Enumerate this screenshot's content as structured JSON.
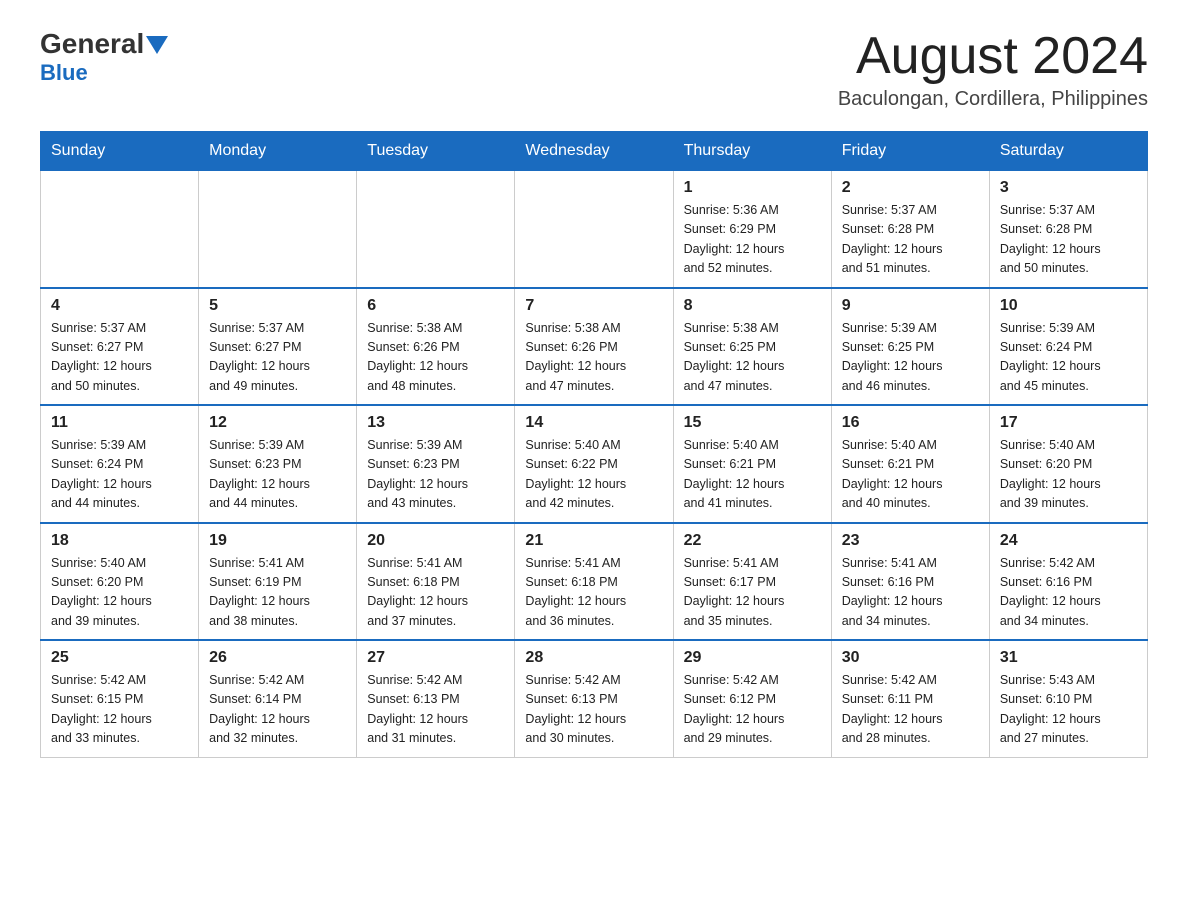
{
  "header": {
    "logo_text": "General",
    "logo_blue": "Blue",
    "title": "August 2024",
    "subtitle": "Baculongan, Cordillera, Philippines"
  },
  "days_of_week": [
    "Sunday",
    "Monday",
    "Tuesday",
    "Wednesday",
    "Thursday",
    "Friday",
    "Saturday"
  ],
  "weeks": [
    [
      {
        "day": "",
        "info": ""
      },
      {
        "day": "",
        "info": ""
      },
      {
        "day": "",
        "info": ""
      },
      {
        "day": "",
        "info": ""
      },
      {
        "day": "1",
        "info": "Sunrise: 5:36 AM\nSunset: 6:29 PM\nDaylight: 12 hours\nand 52 minutes."
      },
      {
        "day": "2",
        "info": "Sunrise: 5:37 AM\nSunset: 6:28 PM\nDaylight: 12 hours\nand 51 minutes."
      },
      {
        "day": "3",
        "info": "Sunrise: 5:37 AM\nSunset: 6:28 PM\nDaylight: 12 hours\nand 50 minutes."
      }
    ],
    [
      {
        "day": "4",
        "info": "Sunrise: 5:37 AM\nSunset: 6:27 PM\nDaylight: 12 hours\nand 50 minutes."
      },
      {
        "day": "5",
        "info": "Sunrise: 5:37 AM\nSunset: 6:27 PM\nDaylight: 12 hours\nand 49 minutes."
      },
      {
        "day": "6",
        "info": "Sunrise: 5:38 AM\nSunset: 6:26 PM\nDaylight: 12 hours\nand 48 minutes."
      },
      {
        "day": "7",
        "info": "Sunrise: 5:38 AM\nSunset: 6:26 PM\nDaylight: 12 hours\nand 47 minutes."
      },
      {
        "day": "8",
        "info": "Sunrise: 5:38 AM\nSunset: 6:25 PM\nDaylight: 12 hours\nand 47 minutes."
      },
      {
        "day": "9",
        "info": "Sunrise: 5:39 AM\nSunset: 6:25 PM\nDaylight: 12 hours\nand 46 minutes."
      },
      {
        "day": "10",
        "info": "Sunrise: 5:39 AM\nSunset: 6:24 PM\nDaylight: 12 hours\nand 45 minutes."
      }
    ],
    [
      {
        "day": "11",
        "info": "Sunrise: 5:39 AM\nSunset: 6:24 PM\nDaylight: 12 hours\nand 44 minutes."
      },
      {
        "day": "12",
        "info": "Sunrise: 5:39 AM\nSunset: 6:23 PM\nDaylight: 12 hours\nand 44 minutes."
      },
      {
        "day": "13",
        "info": "Sunrise: 5:39 AM\nSunset: 6:23 PM\nDaylight: 12 hours\nand 43 minutes."
      },
      {
        "day": "14",
        "info": "Sunrise: 5:40 AM\nSunset: 6:22 PM\nDaylight: 12 hours\nand 42 minutes."
      },
      {
        "day": "15",
        "info": "Sunrise: 5:40 AM\nSunset: 6:21 PM\nDaylight: 12 hours\nand 41 minutes."
      },
      {
        "day": "16",
        "info": "Sunrise: 5:40 AM\nSunset: 6:21 PM\nDaylight: 12 hours\nand 40 minutes."
      },
      {
        "day": "17",
        "info": "Sunrise: 5:40 AM\nSunset: 6:20 PM\nDaylight: 12 hours\nand 39 minutes."
      }
    ],
    [
      {
        "day": "18",
        "info": "Sunrise: 5:40 AM\nSunset: 6:20 PM\nDaylight: 12 hours\nand 39 minutes."
      },
      {
        "day": "19",
        "info": "Sunrise: 5:41 AM\nSunset: 6:19 PM\nDaylight: 12 hours\nand 38 minutes."
      },
      {
        "day": "20",
        "info": "Sunrise: 5:41 AM\nSunset: 6:18 PM\nDaylight: 12 hours\nand 37 minutes."
      },
      {
        "day": "21",
        "info": "Sunrise: 5:41 AM\nSunset: 6:18 PM\nDaylight: 12 hours\nand 36 minutes."
      },
      {
        "day": "22",
        "info": "Sunrise: 5:41 AM\nSunset: 6:17 PM\nDaylight: 12 hours\nand 35 minutes."
      },
      {
        "day": "23",
        "info": "Sunrise: 5:41 AM\nSunset: 6:16 PM\nDaylight: 12 hours\nand 34 minutes."
      },
      {
        "day": "24",
        "info": "Sunrise: 5:42 AM\nSunset: 6:16 PM\nDaylight: 12 hours\nand 34 minutes."
      }
    ],
    [
      {
        "day": "25",
        "info": "Sunrise: 5:42 AM\nSunset: 6:15 PM\nDaylight: 12 hours\nand 33 minutes."
      },
      {
        "day": "26",
        "info": "Sunrise: 5:42 AM\nSunset: 6:14 PM\nDaylight: 12 hours\nand 32 minutes."
      },
      {
        "day": "27",
        "info": "Sunrise: 5:42 AM\nSunset: 6:13 PM\nDaylight: 12 hours\nand 31 minutes."
      },
      {
        "day": "28",
        "info": "Sunrise: 5:42 AM\nSunset: 6:13 PM\nDaylight: 12 hours\nand 30 minutes."
      },
      {
        "day": "29",
        "info": "Sunrise: 5:42 AM\nSunset: 6:12 PM\nDaylight: 12 hours\nand 29 minutes."
      },
      {
        "day": "30",
        "info": "Sunrise: 5:42 AM\nSunset: 6:11 PM\nDaylight: 12 hours\nand 28 minutes."
      },
      {
        "day": "31",
        "info": "Sunrise: 5:43 AM\nSunset: 6:10 PM\nDaylight: 12 hours\nand 27 minutes."
      }
    ]
  ]
}
